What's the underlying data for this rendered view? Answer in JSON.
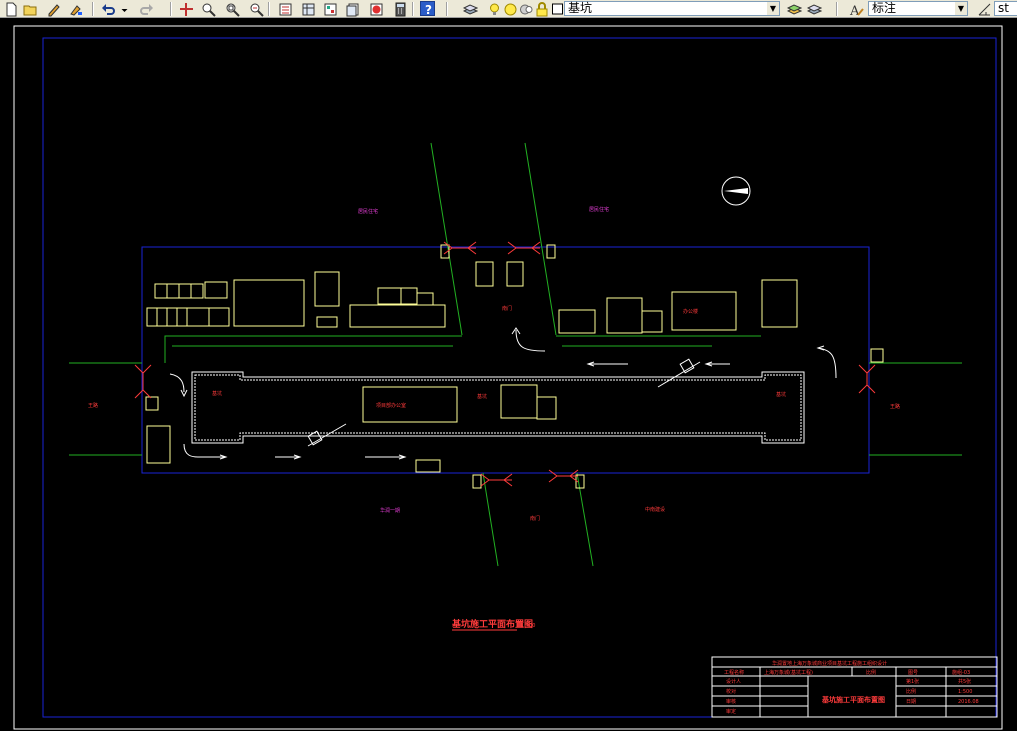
{
  "toolbar": {
    "layer_name": "基坑",
    "style_label": "标注",
    "right_clip": "st",
    "icons": [
      "new-icon",
      "open-icon",
      "edit-icon",
      "paint-icon",
      "undo-icon",
      "redo-icon",
      "pan-icon",
      "zoom-realtime-icon",
      "zoom-window-icon",
      "zoom-previous-icon",
      "properties-icon",
      "design-center-icon",
      "tool-palettes-icon",
      "sheet-set-icon",
      "markup-icon",
      "calculator-icon",
      "help-icon",
      "layer-manager-icon",
      "layer-on-icon",
      "layer-freeze-icon",
      "layer-lock-icon",
      "layer-color-icon",
      "layer-previous-icon",
      "layer-state-icon",
      "text-style-icon",
      "dim-style-icon"
    ]
  },
  "drawing": {
    "colors": {
      "frame": "#1a23d6",
      "building": "#ffff99",
      "road": "#22b022",
      "label_red": "#ff3b3b",
      "label_magenta": "#e53ed6",
      "white": "#ffffff"
    },
    "plot_title": "基坑施工平面布置图",
    "plot_title_scale": "1:500",
    "labels": {
      "north_area": "居民住宅",
      "north_east_area": "居民住宅",
      "south_west_area": "华润一期",
      "south_east_area": "中南建设",
      "west_road": "王路",
      "east_road": "王路",
      "gate_top_center": "南门",
      "gate_bottom_center": "南门",
      "pit_left": "基坑",
      "pit_right": "基坑",
      "pit_center": "基坑",
      "office_main": "项目部办公室",
      "office_right": "办公楼"
    },
    "title_block": {
      "header": "华润置地上海万象城商业项目基坑工程施工组织设计",
      "project_label": "工程名称",
      "project_value": "上海万象城(基坑工程)",
      "scale_label": "比例",
      "drawing_no_label": "图号",
      "drawing_no_value": "施组-03",
      "row_labels": [
        "设计人",
        "校对",
        "审核",
        "审定"
      ],
      "drawing_name": "基坑施工平面布置图",
      "right_pairs": [
        [
          "第1张",
          "共5张"
        ],
        [
          "比例",
          "1:500"
        ],
        [
          "日期",
          "2016.08"
        ]
      ]
    }
  }
}
